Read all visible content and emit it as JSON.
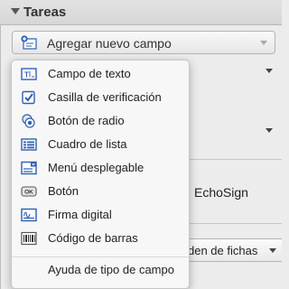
{
  "section": {
    "title": "Tareas"
  },
  "add_field_button": {
    "label": "Agregar nuevo campo",
    "icon": "add-field-icon"
  },
  "background": {
    "integration_text": "EchoSign",
    "tab_order_label": "den de fichas"
  },
  "menu": {
    "items": [
      {
        "label": "Campo de texto",
        "icon": "text-field-icon"
      },
      {
        "label": "Casilla de verificación",
        "icon": "checkbox-icon"
      },
      {
        "label": "Botón de radio",
        "icon": "radio-button-icon"
      },
      {
        "label": "Cuadro de lista",
        "icon": "list-box-icon"
      },
      {
        "label": "Menú desplegable",
        "icon": "dropdown-icon"
      },
      {
        "label": "Botón",
        "icon": "button-icon"
      },
      {
        "label": "Firma digital",
        "icon": "digital-signature-icon"
      },
      {
        "label": "Código de barras",
        "icon": "barcode-icon"
      }
    ],
    "help": "Ayuda de tipo de campo",
    "button_icon_text": "OK"
  },
  "colors": {
    "icon_blue": "#2f5fb3",
    "menu_bg": "#f7f7f7",
    "panel_bg": "#ececec"
  }
}
